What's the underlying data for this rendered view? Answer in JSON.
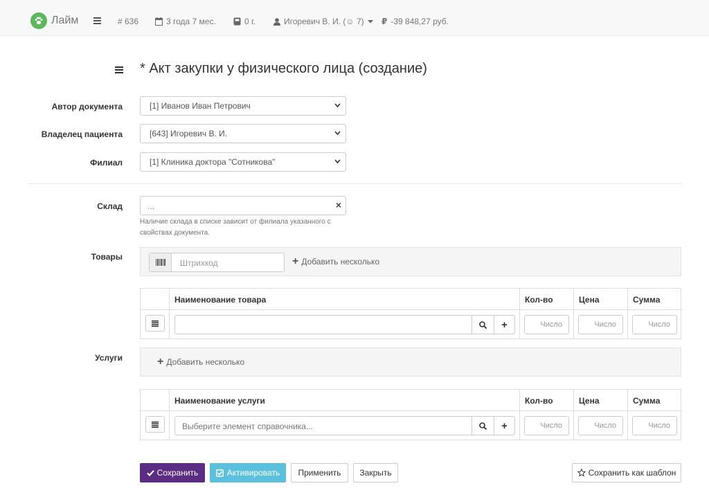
{
  "navbar": {
    "brand": "Лайм",
    "id": "# 636",
    "age": "3 года 7 мес.",
    "weight": "0 г.",
    "owner": "Игоревич В. И. (☺ 7)",
    "balance": "-39 848,27 руб."
  },
  "page": {
    "title": "* Акт закупки у физического лица (создание)"
  },
  "form": {
    "author": {
      "label": "Автор документа",
      "value": "[1] Иванов Иван Петрович"
    },
    "owner": {
      "label": "Владелец пациента",
      "value": "[643] Игоревич В. И."
    },
    "branch": {
      "label": "Филиал",
      "value": "[1] Клиника доктора \"Сотникова\""
    },
    "warehouse": {
      "label": "Склад",
      "value": "...",
      "help_line1": "Наличие склада в списке зависит от филиала указанного с",
      "help_line2": "свойствах документа."
    }
  },
  "goods": {
    "label": "Товары",
    "barcode_placeholder": "Штрихкод",
    "add_several": "Добавить несколько",
    "columns": {
      "name": "Наименование товара",
      "qty": "Кол-во",
      "price": "Цена",
      "sum": "Сумма"
    },
    "row": {
      "name_placeholder": "",
      "qty_placeholder": "Число",
      "price_placeholder": "Число",
      "sum_placeholder": "Число"
    }
  },
  "services": {
    "label": "Услуги",
    "add_several": "Добавить несколько",
    "columns": {
      "name": "Наименование услуги",
      "qty": "Кол-во",
      "price": "Цена",
      "sum": "Сумма"
    },
    "row": {
      "name_placeholder": "Выберите элемент справочника...",
      "qty_placeholder": "Число",
      "price_placeholder": "Число",
      "sum_placeholder": "Число"
    }
  },
  "actions": {
    "save": "Сохранить",
    "activate": "Активировать",
    "apply": "Применить",
    "close": "Закрыть",
    "save_template": "Сохранить как шаблон"
  },
  "colors": {
    "primary": "#5b2c83",
    "info": "#5bc0de",
    "brand": "#5cb85c"
  }
}
